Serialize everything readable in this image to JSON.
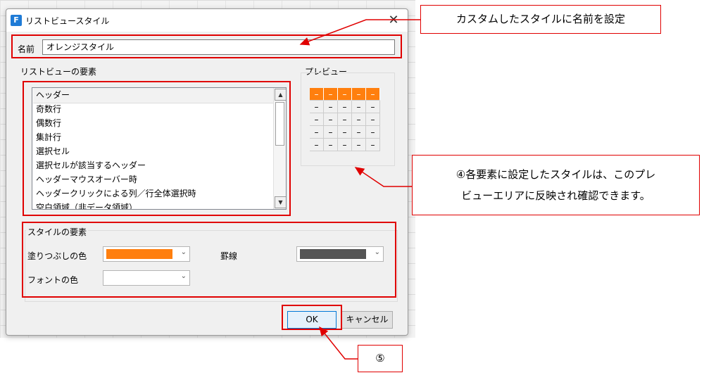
{
  "dialog": {
    "title": "リストビュースタイル",
    "close_glyph": "✕",
    "app_icon_glyph": "F"
  },
  "name_field": {
    "label": "名前",
    "value": "オレンジスタイル"
  },
  "list_group": {
    "label": "リストビューの要素",
    "items": [
      "ヘッダー",
      "奇数行",
      "偶数行",
      "集計行",
      "選択セル",
      "選択セルが該当するヘッダー",
      "ヘッダーマウスオーバー時",
      "ヘッダークリックによる列／行全体選択時",
      "空白領域（非データ領域）"
    ],
    "scroll_up_glyph": "▲",
    "scroll_down_glyph": "▼"
  },
  "preview": {
    "label": "プレビュー",
    "cell_glyph": "–",
    "header_color": "#ff7f0e"
  },
  "style_group": {
    "label": "スタイルの要素",
    "fill_label": "塗りつぶしの色",
    "font_label": "フォントの色",
    "border_label": "罫線",
    "fill_color": "#ff7f0e",
    "font_color": "#ffffff",
    "border_color": "#555555",
    "combo_arrow": "⌄"
  },
  "buttons": {
    "ok": "OK",
    "cancel": "キャンセル"
  },
  "annotations": {
    "name_callout": "カスタムしたスタイルに名前を設定",
    "preview_callout_line1": "④各要素に設定したスタイルは、このプレ",
    "preview_callout_line2": "ビューエリアに反映され確認できます。",
    "ok_callout": "⑤",
    "color": "#e00000"
  }
}
